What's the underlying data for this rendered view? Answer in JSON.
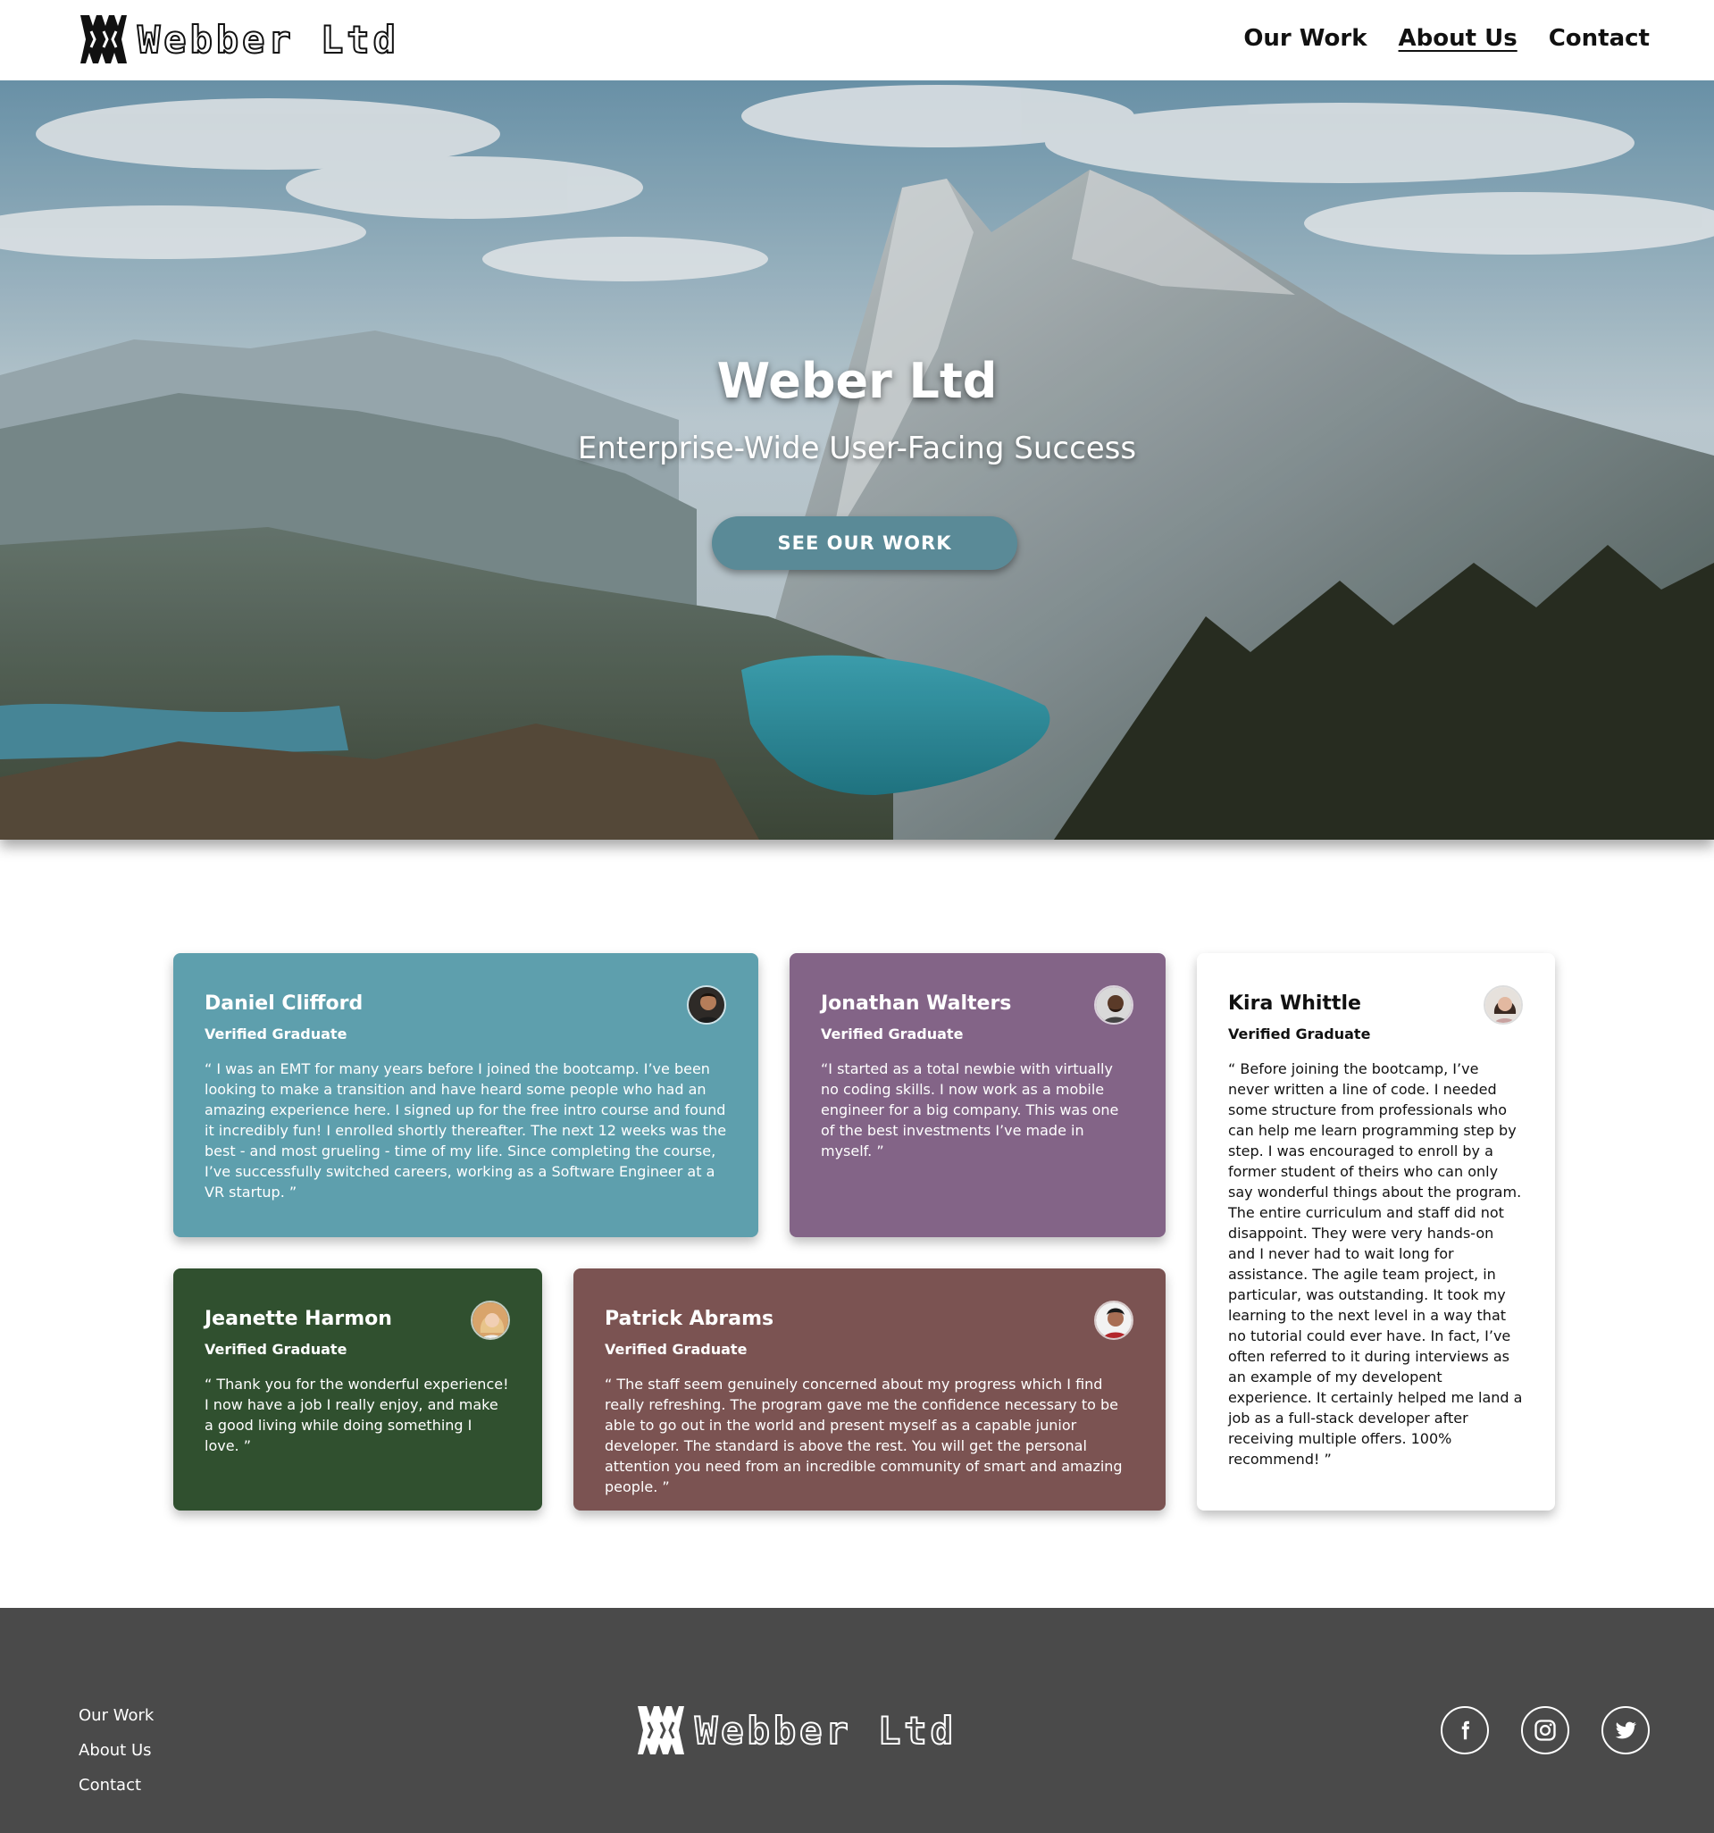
{
  "header": {
    "logo_text": "Webber Ltd",
    "nav": [
      {
        "label": "Our Work"
      },
      {
        "label": "About Us"
      },
      {
        "label": "Contact"
      }
    ]
  },
  "hero": {
    "title": "Weber Ltd",
    "subtitle": "Enterprise-Wide User-Facing Success",
    "button": "SEE OUR WORK"
  },
  "testimonials": {
    "daniel": {
      "name": "Daniel Clifford",
      "role": "Verified Graduate",
      "quote": "“ I was an EMT for many years before I joined the bootcamp. I’ve been looking to make a transition and have heard some people who had an amazing experience here. I signed up for the free intro course and found it incredibly fun! I enrolled shortly thereafter. The next 12 weeks was the best - and most grueling - time of my life. Since completing the course, I’ve successfully switched careers, working as a Software Engineer at a VR startup. ”",
      "color": "#5e9fad"
    },
    "jonathan": {
      "name": "Jonathan Walters",
      "role": "Verified Graduate",
      "quote": "“I started as a total newbie with virtually no coding skills. I now work as a mobile engineer for a big company. This was one of the best investments I’ve made in myself. ”",
      "color": "#836487"
    },
    "kira": {
      "name": "Kira Whittle",
      "role": "Verified Graduate",
      "quote": "“ Before joining the bootcamp, I’ve never written a line of code. I needed some structure from professionals who can help me learn programming step by step. I was encouraged to enroll by a former student of theirs who can only say wonderful things about the program. The entire curriculum and staff did not disappoint. They were very hands-on and I never had to wait long for assistance. The agile team project, in particular, was outstanding. It took my learning to the next level in a way that no tutorial could ever have. In fact, I’ve often referred to it during interviews as an example of my developent experience. It certainly helped me land a job as a full-stack developer after receiving multiple offers. 100% recommend! ”",
      "color": "#ffffff"
    },
    "jeanette": {
      "name": "Jeanette Harmon",
      "role": "Verified Graduate",
      "quote": "“ Thank you for the wonderful experience! I now have a job I really enjoy, and make a good living while doing something I love. ”",
      "color": "#30502f"
    },
    "patrick": {
      "name": "Patrick Abrams",
      "role": "Verified Graduate",
      "quote": "“ The staff seem genuinely concerned about my progress which I find really refreshing. The program gave me the confidence necessary to be able to go out in the world and present myself as a capable junior developer. The standard is above the rest. You will get the personal attention you need from an incredible community of smart and amazing people. ”",
      "color": "#7b5352"
    }
  },
  "footer": {
    "links": [
      {
        "label": "Our Work"
      },
      {
        "label": "About Us"
      },
      {
        "label": "Contact"
      }
    ],
    "logo_text": "Webber Ltd",
    "social": [
      "facebook-icon",
      "instagram-icon",
      "twitter-icon"
    ]
  }
}
